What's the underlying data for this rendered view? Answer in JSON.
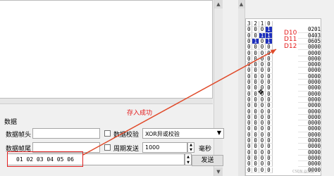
{
  "left": {
    "section_title": "数据",
    "frame_head_label": "数据帧头",
    "frame_tail_label": "数据帧尾",
    "checksum_check_label": "数据校验",
    "checksum_type": "XOR异或校验",
    "periodic_label": "周期发送",
    "period_value": "1000",
    "period_unit": "毫秒",
    "send_data": "01 02 03 04 05 06",
    "send_button": "发送",
    "annotation": "存入成功"
  },
  "table": {
    "header": [
      "3",
      "2",
      "1",
      "0"
    ],
    "rows": [
      [
        "0",
        "0",
        "0",
        "1"
      ],
      [
        "0",
        "0",
        "1",
        "1"
      ],
      [
        "0",
        "1",
        "0",
        "1"
      ],
      [
        "0",
        "0",
        "0",
        "0"
      ],
      [
        "0",
        "0",
        "0",
        "0"
      ],
      [
        "0",
        "0",
        "0",
        "0"
      ],
      [
        "0",
        "0",
        "0",
        "0"
      ],
      [
        "0",
        "0",
        "0",
        "0"
      ],
      [
        "0",
        "0",
        "0",
        "0"
      ],
      [
        "0",
        "0",
        "0",
        "0"
      ],
      [
        "0",
        "0",
        "0",
        "0"
      ],
      [
        "0",
        "0",
        "0",
        "0"
      ],
      [
        "0",
        "0",
        "0",
        "0"
      ],
      [
        "0",
        "0",
        "0",
        "0"
      ],
      [
        "0",
        "0",
        "0",
        "0"
      ],
      [
        "0",
        "0",
        "0",
        "0"
      ],
      [
        "0",
        "0",
        "0",
        "0"
      ],
      [
        "0",
        "0",
        "0",
        "0"
      ],
      [
        "0",
        "0",
        "0",
        "0"
      ],
      [
        "0",
        "0",
        "0",
        "0"
      ],
      [
        "0",
        "0",
        "0",
        "0"
      ],
      [
        "0",
        "0",
        "0",
        "0"
      ],
      [
        "0",
        "0",
        "0",
        "0"
      ],
      [
        "0",
        "0",
        "0",
        "0"
      ],
      [
        "0",
        "0",
        "0",
        "0"
      ]
    ],
    "d_labels": [
      "D10",
      "D11",
      "D12"
    ],
    "values": [
      "0201",
      "0403",
      "0605",
      "0000",
      "0000",
      "0000",
      "0000",
      "0000",
      "0000",
      "0000",
      "0000",
      "0000",
      "0000",
      "0000",
      "0000",
      "0000",
      "0000",
      "0000",
      "0000",
      "0000",
      "0000",
      "0000",
      "0000",
      "0000",
      "0000"
    ]
  },
  "watermark": "CSDN @灵迷",
  "colors": {
    "selection": "#1d2fbd",
    "annotation": "#e41a1a",
    "arrow": "#e04a2a"
  },
  "icons": {
    "scroll_up": "chevron-up-icon",
    "scroll_down": "chevron-down-icon",
    "cursor": "crosshair-cursor-icon"
  }
}
